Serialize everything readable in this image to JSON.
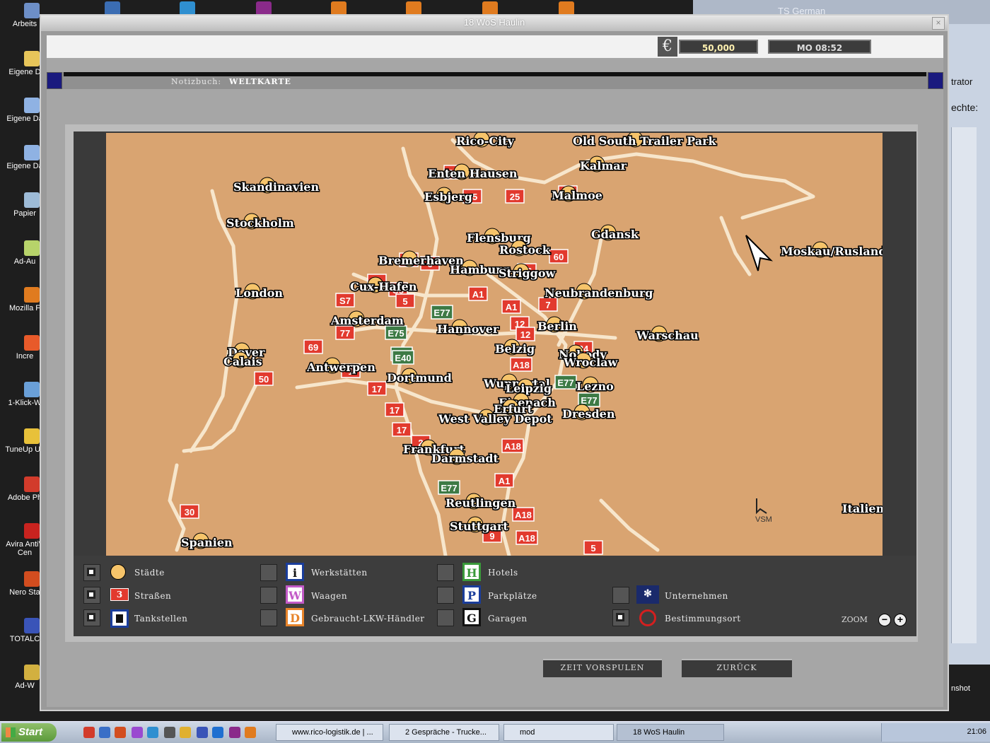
{
  "desktop": {
    "icons": [
      "Arbeits",
      "Eigene D",
      "Eigene Da",
      "Eigene Da",
      "Papier",
      "Ad-Au",
      "Mozilla F",
      "Incre",
      "1-Klick-W",
      "TuneUp Uti",
      "Adobe Ph",
      "Avira AntiV Cen",
      "Nero Sta",
      "TOTALC",
      "Ad-W"
    ]
  },
  "background_window": {
    "title": "TS German",
    "text_a": "trator",
    "text_b": "echte:",
    "text_c": "nshot"
  },
  "window": {
    "title": "18 WoS Haulin",
    "close_label": "×"
  },
  "status": {
    "currency_symbol": "€",
    "money": "50,000",
    "clock": "MO 08:52"
  },
  "notebook": {
    "label": "Notizbuch:",
    "value": "WELTKARTE"
  },
  "map": {
    "cities": [
      {
        "name": "Rico-City"
      },
      {
        "name": "Old South Trailer Park"
      },
      {
        "name": "Kalmar"
      },
      {
        "name": "Enten Hausen"
      },
      {
        "name": "Esbjerg"
      },
      {
        "name": "Malmoe"
      },
      {
        "name": "Skandinavien"
      },
      {
        "name": "Stockholm"
      },
      {
        "name": "Gdansk"
      },
      {
        "name": "Flensburg"
      },
      {
        "name": "Rostock"
      },
      {
        "name": "Moskau/Rusland"
      },
      {
        "name": "Bremerhaven"
      },
      {
        "name": "Hamburg"
      },
      {
        "name": "Striggow"
      },
      {
        "name": "Cux-Hafen"
      },
      {
        "name": "Neubrandenburg"
      },
      {
        "name": "London"
      },
      {
        "name": "Amsterdam"
      },
      {
        "name": "Hannover"
      },
      {
        "name": "Berlin"
      },
      {
        "name": "Warschau"
      },
      {
        "name": "Belzig"
      },
      {
        "name": "Dover"
      },
      {
        "name": "Calais"
      },
      {
        "name": "Antwerpen"
      },
      {
        "name": "Nobody"
      },
      {
        "name": "Wroclaw"
      },
      {
        "name": "Dortmund"
      },
      {
        "name": "Wuppertal"
      },
      {
        "name": "Leipzig"
      },
      {
        "name": "Lezno"
      },
      {
        "name": "Eisenach"
      },
      {
        "name": "Erfurt"
      },
      {
        "name": "Dresden"
      },
      {
        "name": "West Valley Depot"
      },
      {
        "name": "Frankfurt"
      },
      {
        "name": "Darmstadt"
      },
      {
        "name": "Reutlingen"
      },
      {
        "name": "Stuttgart"
      },
      {
        "name": "Spanien"
      },
      {
        "name": "Italien/Mailand"
      }
    ],
    "road_signs": [
      "61",
      "25",
      "25",
      "50",
      "6",
      "6",
      "60",
      "5",
      "S8",
      "16",
      "S7",
      "5",
      "A1",
      "A1",
      "7",
      "E77",
      "E75",
      "E40",
      "77",
      "69",
      "E40",
      "12",
      "12",
      "24",
      "1",
      "50",
      "17",
      "A18",
      "E77",
      "E77",
      "17",
      "17",
      "2",
      "A18",
      "E77",
      "A1",
      "A18",
      "A18",
      "9",
      "5",
      "30"
    ],
    "watermark": "VSM"
  },
  "legend": {
    "items": [
      {
        "key": "staedte",
        "label": "Städte",
        "checked": true,
        "icon": "city-dot-icon"
      },
      {
        "key": "strassen",
        "label": "Straßen",
        "checked": true,
        "icon": "road-number-icon",
        "icon_text": "3"
      },
      {
        "key": "tankstellen",
        "label": "Tankstellen",
        "checked": true,
        "icon": "fuel-pump-icon"
      },
      {
        "key": "werkstaetten",
        "label": "Werkstätten",
        "checked": false,
        "icon": "workshop-icon",
        "icon_text": "i"
      },
      {
        "key": "waagen",
        "label": "Waagen",
        "checked": false,
        "icon": "weigh-station-icon",
        "icon_text": "W"
      },
      {
        "key": "haendler",
        "label": "Gebraucht-LKW-Händler",
        "checked": false,
        "icon": "used-truck-dealer-icon",
        "icon_text": "D"
      },
      {
        "key": "hotels",
        "label": "Hotels",
        "checked": false,
        "icon": "hotel-icon",
        "icon_text": "H"
      },
      {
        "key": "parkplaetze",
        "label": "Parkplätze",
        "checked": false,
        "icon": "parking-icon",
        "icon_text": "P"
      },
      {
        "key": "garagen",
        "label": "Garagen",
        "checked": false,
        "icon": "garage-icon",
        "icon_text": "G"
      },
      {
        "key": "unternehmen",
        "label": "Unternehmen",
        "checked": false,
        "icon": "company-icon"
      },
      {
        "key": "bestimmungsort",
        "label": "Bestimmungsort",
        "checked": true,
        "icon": "destination-ring-icon"
      }
    ],
    "zoom_label": "ZOOM",
    "zoom_out": "−",
    "zoom_in": "+"
  },
  "buttons": {
    "fast_forward": "ZEIT VORSPULEN",
    "back": "ZURÜCK"
  },
  "taskbar": {
    "start": "Start",
    "tasks": [
      "www.rico-logistik.de | ...",
      "2 Gespräche - Trucke...",
      "mod",
      "18 WoS Haulin"
    ],
    "time": "21:06"
  },
  "colors": {
    "map_land": "#d9a471",
    "road": "#f7e6cc",
    "road_sign_red": "#e23a2e",
    "road_sign_green": "#3d7a45",
    "city_dot": "#f6c46a",
    "panel_dark": "#3d3d3d"
  }
}
